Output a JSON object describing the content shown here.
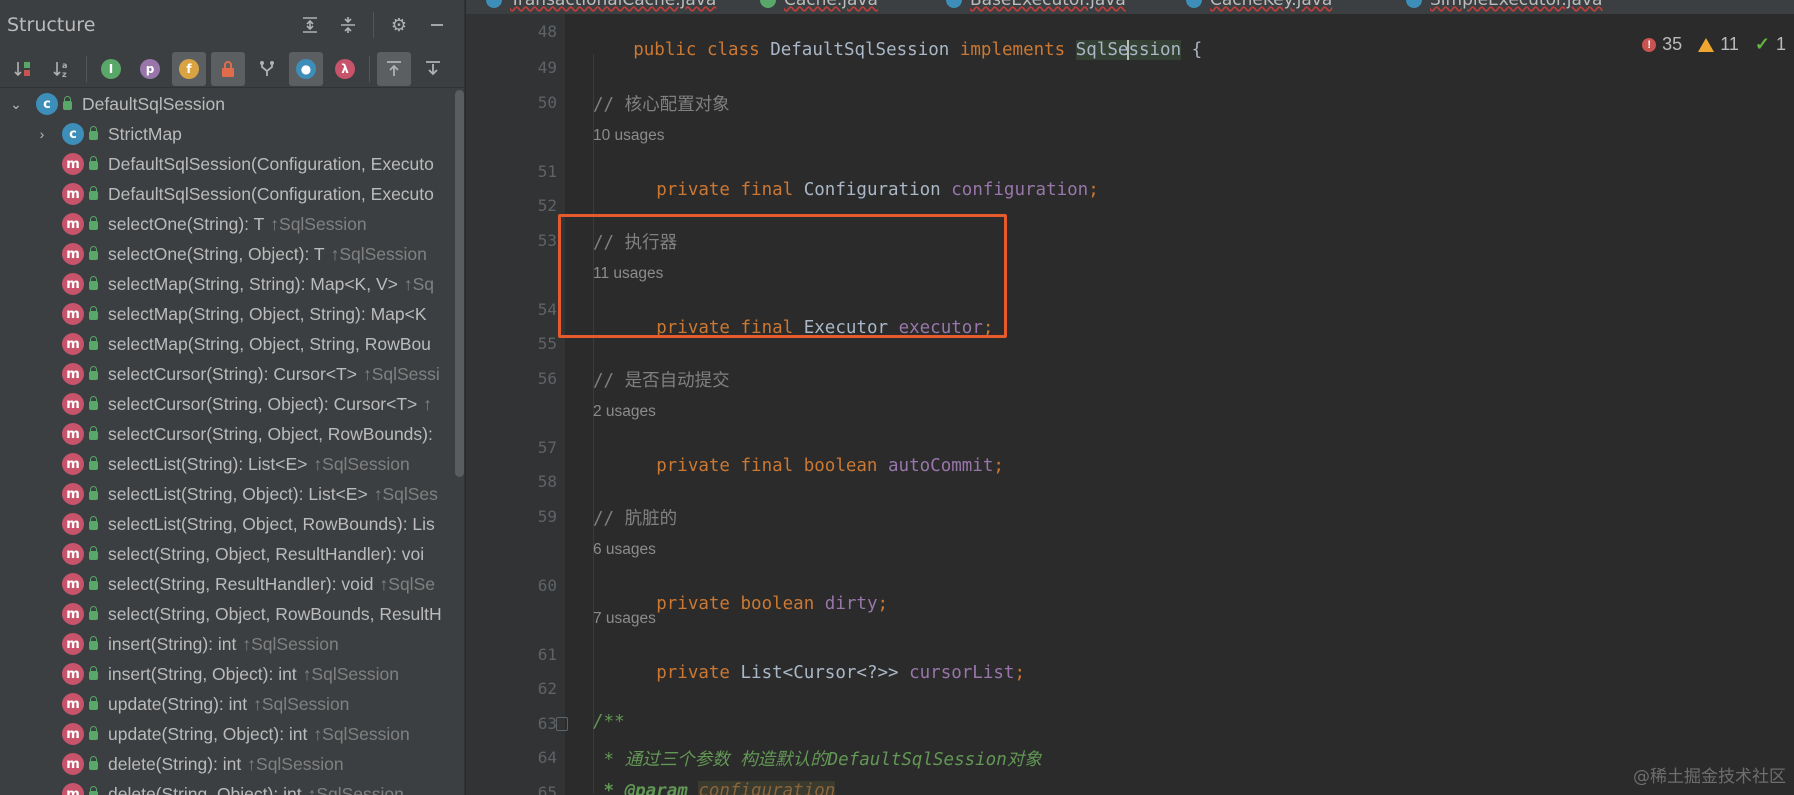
{
  "structure_panel": {
    "title": "Structure",
    "tree": [
      {
        "icon": "c",
        "label": "DefaultSqlSession",
        "super": "",
        "arrow": "⌄"
      },
      {
        "icon": "c",
        "label": "StrictMap",
        "super": "",
        "arrow": "›"
      },
      {
        "icon": "m",
        "label": "DefaultSqlSession(Configuration, Executo",
        "super": ""
      },
      {
        "icon": "m",
        "label": "DefaultSqlSession(Configuration, Executo",
        "super": ""
      },
      {
        "icon": "m",
        "label": "selectOne(String): T",
        "super": "↑SqlSession"
      },
      {
        "icon": "m",
        "label": "selectOne(String, Object): T",
        "super": "↑SqlSession"
      },
      {
        "icon": "m",
        "label": "selectMap(String, String): Map<K, V>",
        "super": "↑Sq"
      },
      {
        "icon": "m",
        "label": "selectMap(String, Object, String): Map<K",
        "super": ""
      },
      {
        "icon": "m",
        "label": "selectMap(String, Object, String, RowBou",
        "super": ""
      },
      {
        "icon": "m",
        "label": "selectCursor(String): Cursor<T>",
        "super": "↑SqlSessi"
      },
      {
        "icon": "m",
        "label": "selectCursor(String, Object): Cursor<T>",
        "super": "↑"
      },
      {
        "icon": "m",
        "label": "selectCursor(String, Object, RowBounds):",
        "super": ""
      },
      {
        "icon": "m",
        "label": "selectList(String): List<E>",
        "super": "↑SqlSession"
      },
      {
        "icon": "m",
        "label": "selectList(String, Object): List<E>",
        "super": "↑SqlSes"
      },
      {
        "icon": "m",
        "label": "selectList(String, Object, RowBounds): Lis",
        "super": ""
      },
      {
        "icon": "m",
        "label": "select(String, Object, ResultHandler): voi",
        "super": ""
      },
      {
        "icon": "m",
        "label": "select(String, ResultHandler): void",
        "super": "↑SqlSe"
      },
      {
        "icon": "m",
        "label": "select(String, Object, RowBounds, ResultH",
        "super": ""
      },
      {
        "icon": "m",
        "label": "insert(String): int",
        "super": "↑SqlSession"
      },
      {
        "icon": "m",
        "label": "insert(String, Object): int",
        "super": "↑SqlSession"
      },
      {
        "icon": "m",
        "label": "update(String): int",
        "super": "↑SqlSession"
      },
      {
        "icon": "m",
        "label": "update(String, Object): int",
        "super": "↑SqlSession"
      },
      {
        "icon": "m",
        "label": "delete(String): int",
        "super": "↑SqlSession"
      },
      {
        "icon": "m",
        "label": "delete(String, Object): int",
        "super": "↑SqlSession"
      }
    ]
  },
  "tabs": [
    {
      "label": "TransactionalCache.java",
      "color": "#3d8eb8"
    },
    {
      "label": "Cache.java",
      "color": "#59a869"
    },
    {
      "label": "BaseExecutor.java",
      "color": "#3d8eb8"
    },
    {
      "label": "CacheKey.java",
      "color": "#3d8eb8"
    },
    {
      "label": "SimpleExecutor.java",
      "color": "#3d8eb8"
    }
  ],
  "editor": {
    "line_numbers": [
      "48",
      "49",
      "50",
      "51",
      "52",
      "53",
      "54",
      "55",
      "56",
      "57",
      "58",
      "59",
      "60",
      "61",
      "62",
      "63",
      "64",
      "65"
    ],
    "line48": {
      "p1": "public class ",
      "cls": "DefaultSqlSession",
      "p2": " implements ",
      "ifc_a": "SqlSe",
      "ifc_b": "ssion",
      "p3": " {"
    },
    "c50": "// 核心配置对象",
    "u51": "10 usages",
    "l51": {
      "kw": "private final ",
      "type": "Configuration ",
      "field": "configuration",
      "end": ";"
    },
    "c53": "// 执行器",
    "u54": "11 usages",
    "l54": {
      "kw": "private final ",
      "type": "Executor ",
      "field": "executor",
      "end": ";"
    },
    "c56": "// 是否自动提交",
    "u57": "2 usages",
    "l57": {
      "kw": "private final boolean ",
      "field": "autoCommit",
      "end": ";"
    },
    "c59": "// 肮脏的",
    "u60": "6 usages",
    "l60": {
      "kw": "private boolean ",
      "field": "dirty",
      "end": ";"
    },
    "u61": "7 usages",
    "l61": {
      "kw": "private ",
      "type": "List<Cursor<?>> ",
      "field": "cursorList",
      "end": ";"
    },
    "l63": "/**",
    "l64": " * 通过三个参数 构造默认的DefaultSqlSession对象",
    "l65a": " * @param ",
    "l65b": "configuration"
  },
  "inspections": {
    "errors": "35",
    "warnings": "11",
    "weak": "1"
  },
  "watermark": "@稀土掘金技术社区"
}
